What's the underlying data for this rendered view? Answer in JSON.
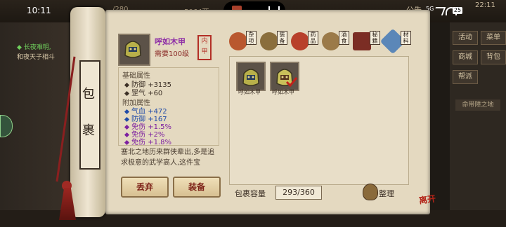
{
  "status_bar": {
    "time": "10:11",
    "sig": "5G",
    "battery": "25",
    "clock_right": "22:11"
  },
  "game_top": {
    "res1": "/280",
    "res2": "5064两"
  },
  "game_left": {
    "line1": "◆ 长夜难明,",
    "line2": "和夜天子相斗"
  },
  "right_menu": [
    "活动",
    "菜单",
    "商城",
    "背包",
    "帮派"
  ],
  "right_hint": "命带障之地",
  "top_right": "公告",
  "roller_chars": [
    "包",
    "裹"
  ],
  "item": {
    "name": "呼如木甲",
    "requirement": "需要100级",
    "seal": "内甲",
    "base_title": "基础属性",
    "base_stats": [
      {
        "label": "防御",
        "value": "+3135"
      },
      {
        "label": "罡气",
        "value": "+60"
      }
    ],
    "extra_title": "附加属性",
    "extra_stats": [
      {
        "label": "气血",
        "value": "+472"
      },
      {
        "label": "防御",
        "value": "+167"
      },
      {
        "label": "免伤",
        "value": "+1.5%"
      },
      {
        "label": "免伤",
        "value": "+2%"
      },
      {
        "label": "免伤",
        "value": "+1.8%"
      }
    ],
    "description": "塞北之地历来群侠辈出,多是追求极意的武学高人,这件宝"
  },
  "buttons": {
    "discard": "丢弃",
    "equip": "装备",
    "sort": "整理"
  },
  "tabs": [
    {
      "label": "杂项",
      "color": "#b9582f"
    },
    {
      "label": "装备",
      "color": "#8a6e3c"
    },
    {
      "label": "药品",
      "color": "#b8402b"
    },
    {
      "label": "酒食",
      "color": "#9b7a49"
    },
    {
      "label": "秘籍",
      "color": "#7b2d24"
    },
    {
      "label": "材料",
      "color": "#5b87b8"
    }
  ],
  "bag_items": [
    {
      "name": "呼如木甲",
      "checked": false
    },
    {
      "name": "呼如木甲",
      "checked": true
    }
  ],
  "capacity": {
    "label": "包裹容量",
    "value": "293/360"
  },
  "corner_stamp": "离开"
}
